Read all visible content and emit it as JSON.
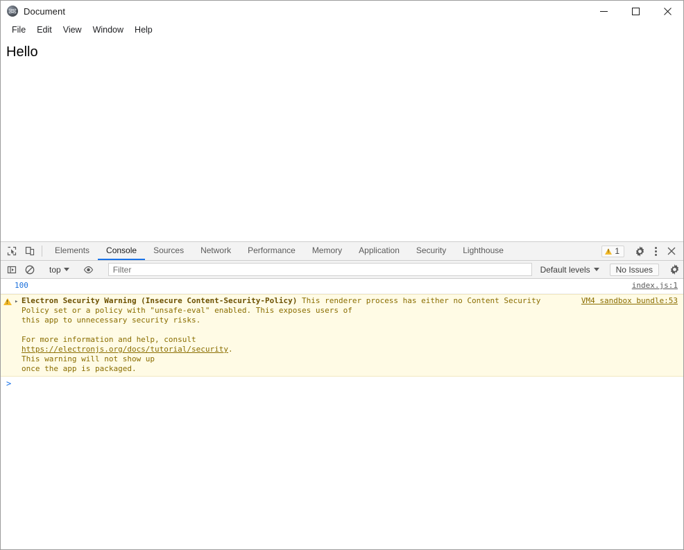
{
  "window": {
    "title": "Document",
    "app_icon": "electron-icon",
    "controls": {
      "minimize": "minimize-icon",
      "maximize": "maximize-icon",
      "close": "close-icon"
    }
  },
  "menubar": {
    "items": [
      {
        "label": "File"
      },
      {
        "label": "Edit"
      },
      {
        "label": "View"
      },
      {
        "label": "Window"
      },
      {
        "label": "Help"
      }
    ]
  },
  "page": {
    "heading": "Hello"
  },
  "devtools": {
    "toolbar_icons": {
      "inspect": "inspect-element-icon",
      "device": "device-toolbar-icon"
    },
    "tabs": [
      {
        "label": "Elements",
        "active": false
      },
      {
        "label": "Console",
        "active": true
      },
      {
        "label": "Sources",
        "active": false
      },
      {
        "label": "Network",
        "active": false
      },
      {
        "label": "Performance",
        "active": false
      },
      {
        "label": "Memory",
        "active": false
      },
      {
        "label": "Application",
        "active": false
      },
      {
        "label": "Security",
        "active": false
      },
      {
        "label": "Lighthouse",
        "active": false
      }
    ],
    "warning_badge": {
      "count": "1",
      "icon": "warning-triangle-icon"
    },
    "actions": {
      "settings": "gear-icon",
      "more": "kebab-menu-icon",
      "close": "close-icon"
    },
    "filterbar": {
      "sidebar_toggle": "console-sidebar-icon",
      "clear_console": "clear-console-icon",
      "context": "top",
      "eye": "eye-icon",
      "filter_placeholder": "Filter",
      "filter_value": "",
      "levels": "Default levels",
      "issues": "No Issues",
      "settings": "gear-icon"
    },
    "console": {
      "entries": [
        {
          "type": "log",
          "text": "100",
          "source": "index.js:1"
        },
        {
          "type": "warning",
          "disclosure": "▸",
          "title_bold": "Electron Security Warning (Insecure Content-Security-Policy)",
          "body_1": " This renderer process has either no Content Security\nPolicy set or a policy with \"unsafe-eval\" enabled. This exposes users of\nthis app to unnecessary security risks.\n\nFor more information and help, consult\n",
          "link": "https://electronjs.org/docs/tutorial/security",
          "body_2": ".\nThis warning will not show up\nonce the app is packaged.",
          "source": "VM4 sandbox bundle:53"
        }
      ],
      "prompt_caret": ">"
    }
  },
  "colors": {
    "accent": "#1a73e8",
    "warning_bg": "#fffbe5",
    "warning_text": "#8a6d00",
    "warning_icon": "#f2ba2c",
    "number_value": "#1a6fdb",
    "toolbar_bg": "#f3f3f3",
    "border": "#cdcdcd"
  }
}
